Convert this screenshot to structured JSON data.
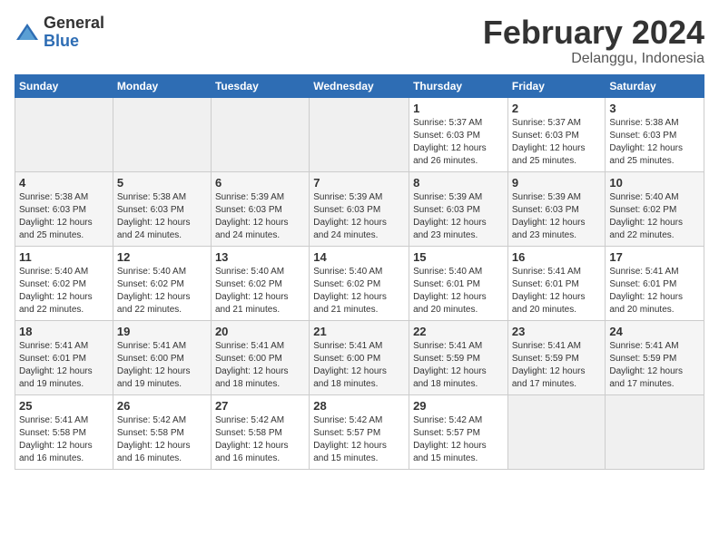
{
  "header": {
    "logo_general": "General",
    "logo_blue": "Blue",
    "month": "February 2024",
    "location": "Delanggu, Indonesia"
  },
  "weekdays": [
    "Sunday",
    "Monday",
    "Tuesday",
    "Wednesday",
    "Thursday",
    "Friday",
    "Saturday"
  ],
  "weeks": [
    [
      {
        "day": "",
        "info": ""
      },
      {
        "day": "",
        "info": ""
      },
      {
        "day": "",
        "info": ""
      },
      {
        "day": "",
        "info": ""
      },
      {
        "day": "1",
        "info": "Sunrise: 5:37 AM\nSunset: 6:03 PM\nDaylight: 12 hours\nand 26 minutes."
      },
      {
        "day": "2",
        "info": "Sunrise: 5:37 AM\nSunset: 6:03 PM\nDaylight: 12 hours\nand 25 minutes."
      },
      {
        "day": "3",
        "info": "Sunrise: 5:38 AM\nSunset: 6:03 PM\nDaylight: 12 hours\nand 25 minutes."
      }
    ],
    [
      {
        "day": "4",
        "info": "Sunrise: 5:38 AM\nSunset: 6:03 PM\nDaylight: 12 hours\nand 25 minutes."
      },
      {
        "day": "5",
        "info": "Sunrise: 5:38 AM\nSunset: 6:03 PM\nDaylight: 12 hours\nand 24 minutes."
      },
      {
        "day": "6",
        "info": "Sunrise: 5:39 AM\nSunset: 6:03 PM\nDaylight: 12 hours\nand 24 minutes."
      },
      {
        "day": "7",
        "info": "Sunrise: 5:39 AM\nSunset: 6:03 PM\nDaylight: 12 hours\nand 24 minutes."
      },
      {
        "day": "8",
        "info": "Sunrise: 5:39 AM\nSunset: 6:03 PM\nDaylight: 12 hours\nand 23 minutes."
      },
      {
        "day": "9",
        "info": "Sunrise: 5:39 AM\nSunset: 6:03 PM\nDaylight: 12 hours\nand 23 minutes."
      },
      {
        "day": "10",
        "info": "Sunrise: 5:40 AM\nSunset: 6:02 PM\nDaylight: 12 hours\nand 22 minutes."
      }
    ],
    [
      {
        "day": "11",
        "info": "Sunrise: 5:40 AM\nSunset: 6:02 PM\nDaylight: 12 hours\nand 22 minutes."
      },
      {
        "day": "12",
        "info": "Sunrise: 5:40 AM\nSunset: 6:02 PM\nDaylight: 12 hours\nand 22 minutes."
      },
      {
        "day": "13",
        "info": "Sunrise: 5:40 AM\nSunset: 6:02 PM\nDaylight: 12 hours\nand 21 minutes."
      },
      {
        "day": "14",
        "info": "Sunrise: 5:40 AM\nSunset: 6:02 PM\nDaylight: 12 hours\nand 21 minutes."
      },
      {
        "day": "15",
        "info": "Sunrise: 5:40 AM\nSunset: 6:01 PM\nDaylight: 12 hours\nand 20 minutes."
      },
      {
        "day": "16",
        "info": "Sunrise: 5:41 AM\nSunset: 6:01 PM\nDaylight: 12 hours\nand 20 minutes."
      },
      {
        "day": "17",
        "info": "Sunrise: 5:41 AM\nSunset: 6:01 PM\nDaylight: 12 hours\nand 20 minutes."
      }
    ],
    [
      {
        "day": "18",
        "info": "Sunrise: 5:41 AM\nSunset: 6:01 PM\nDaylight: 12 hours\nand 19 minutes."
      },
      {
        "day": "19",
        "info": "Sunrise: 5:41 AM\nSunset: 6:00 PM\nDaylight: 12 hours\nand 19 minutes."
      },
      {
        "day": "20",
        "info": "Sunrise: 5:41 AM\nSunset: 6:00 PM\nDaylight: 12 hours\nand 18 minutes."
      },
      {
        "day": "21",
        "info": "Sunrise: 5:41 AM\nSunset: 6:00 PM\nDaylight: 12 hours\nand 18 minutes."
      },
      {
        "day": "22",
        "info": "Sunrise: 5:41 AM\nSunset: 5:59 PM\nDaylight: 12 hours\nand 18 minutes."
      },
      {
        "day": "23",
        "info": "Sunrise: 5:41 AM\nSunset: 5:59 PM\nDaylight: 12 hours\nand 17 minutes."
      },
      {
        "day": "24",
        "info": "Sunrise: 5:41 AM\nSunset: 5:59 PM\nDaylight: 12 hours\nand 17 minutes."
      }
    ],
    [
      {
        "day": "25",
        "info": "Sunrise: 5:41 AM\nSunset: 5:58 PM\nDaylight: 12 hours\nand 16 minutes."
      },
      {
        "day": "26",
        "info": "Sunrise: 5:42 AM\nSunset: 5:58 PM\nDaylight: 12 hours\nand 16 minutes."
      },
      {
        "day": "27",
        "info": "Sunrise: 5:42 AM\nSunset: 5:58 PM\nDaylight: 12 hours\nand 16 minutes."
      },
      {
        "day": "28",
        "info": "Sunrise: 5:42 AM\nSunset: 5:57 PM\nDaylight: 12 hours\nand 15 minutes."
      },
      {
        "day": "29",
        "info": "Sunrise: 5:42 AM\nSunset: 5:57 PM\nDaylight: 12 hours\nand 15 minutes."
      },
      {
        "day": "",
        "info": ""
      },
      {
        "day": "",
        "info": ""
      }
    ]
  ]
}
